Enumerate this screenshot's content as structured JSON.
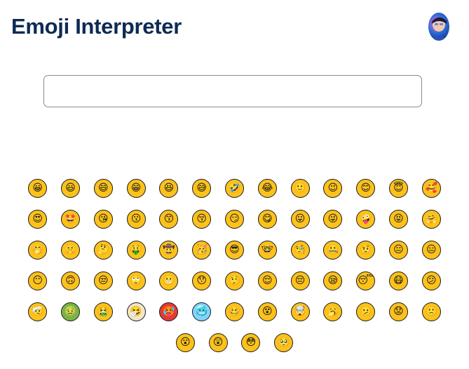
{
  "header": {
    "title": "Emoji Interpreter"
  },
  "search": {
    "value": "",
    "placeholder": ""
  },
  "colors": {
    "title": "#0d2a52",
    "face_yellow": "#fcc21b",
    "face_green": "#7cb342",
    "face_red": "#e53935",
    "face_blue": "#81d4fa",
    "face_pale": "#f2e6c9",
    "outline": "#1a1a1a"
  },
  "emojis": [
    {
      "name": "grinning-face",
      "glyph": "😀",
      "color": "#fcc21b"
    },
    {
      "name": "grinning-face-big-eyes",
      "glyph": "😃",
      "color": "#fcc21b"
    },
    {
      "name": "grinning-face-smiling-eyes",
      "glyph": "😄",
      "color": "#fcc21b"
    },
    {
      "name": "beaming-face",
      "glyph": "😁",
      "color": "#fcc21b"
    },
    {
      "name": "squinting-laughing-face",
      "glyph": "😆",
      "color": "#fcc21b"
    },
    {
      "name": "grinning-sweat-face",
      "glyph": "😅",
      "color": "#fcc21b"
    },
    {
      "name": "rolling-laughing-face",
      "glyph": "🤣",
      "color": "#fcc21b"
    },
    {
      "name": "tears-of-joy-face",
      "glyph": "😂",
      "color": "#fcc21b"
    },
    {
      "name": "slightly-smiling-face",
      "glyph": "🙂",
      "color": "#fcc21b"
    },
    {
      "name": "winking-face",
      "glyph": "😉",
      "color": "#fcc21b"
    },
    {
      "name": "smiling-eyes-face",
      "glyph": "😊",
      "color": "#fcc21b"
    },
    {
      "name": "halo-face",
      "glyph": "😇",
      "color": "#fcc21b"
    },
    {
      "name": "smiling-hearts-face",
      "glyph": "🥰",
      "color": "#fcc21b"
    },
    {
      "name": "heart-eyes-face",
      "glyph": "😍",
      "color": "#fcc21b"
    },
    {
      "name": "star-struck-face",
      "glyph": "🤩",
      "color": "#fcc21b"
    },
    {
      "name": "blowing-kiss-face",
      "glyph": "😘",
      "color": "#fcc21b"
    },
    {
      "name": "kissing-face",
      "glyph": "😗",
      "color": "#fcc21b"
    },
    {
      "name": "kissing-smiling-eyes-face",
      "glyph": "😙",
      "color": "#fcc21b"
    },
    {
      "name": "kissing-closed-eyes-face",
      "glyph": "😚",
      "color": "#fcc21b"
    },
    {
      "name": "smirking-face",
      "glyph": "😏",
      "color": "#fcc21b"
    },
    {
      "name": "yum-face",
      "glyph": "😋",
      "color": "#fcc21b"
    },
    {
      "name": "tongue-face",
      "glyph": "😛",
      "color": "#fcc21b"
    },
    {
      "name": "winking-tongue-face",
      "glyph": "😜",
      "color": "#fcc21b"
    },
    {
      "name": "zany-face",
      "glyph": "🤪",
      "color": "#fcc21b"
    },
    {
      "name": "squinting-tongue-face",
      "glyph": "😝",
      "color": "#fcc21b"
    },
    {
      "name": "hugging-face",
      "glyph": "🤗",
      "color": "#fcc21b"
    },
    {
      "name": "hand-over-mouth-face",
      "glyph": "🤭",
      "color": "#fcc21b"
    },
    {
      "name": "shushing-face",
      "glyph": "🤫",
      "color": "#fcc21b"
    },
    {
      "name": "thinking-face",
      "glyph": "🤔",
      "color": "#fcc21b"
    },
    {
      "name": "money-tongue-face",
      "glyph": "🤑",
      "color": "#fcc21b"
    },
    {
      "name": "cowboy-face",
      "glyph": "🤠",
      "color": "#fcc21b"
    },
    {
      "name": "partying-face",
      "glyph": "🥳",
      "color": "#fcc21b"
    },
    {
      "name": "sunglasses-face",
      "glyph": "😎",
      "color": "#fcc21b"
    },
    {
      "name": "nerd-face",
      "glyph": "🤓",
      "color": "#fcc21b"
    },
    {
      "name": "monocle-face",
      "glyph": "🧐",
      "color": "#fcc21b"
    },
    {
      "name": "zipper-mouth-face",
      "glyph": "🤐",
      "color": "#fcc21b"
    },
    {
      "name": "raised-eyebrow-face",
      "glyph": "🤨",
      "color": "#fcc21b"
    },
    {
      "name": "neutral-face",
      "glyph": "😐",
      "color": "#fcc21b"
    },
    {
      "name": "expressionless-face",
      "glyph": "😑",
      "color": "#fcc21b"
    },
    {
      "name": "no-mouth-face",
      "glyph": "😶",
      "color": "#fcc21b"
    },
    {
      "name": "upside-down-face",
      "glyph": "🙃",
      "color": "#fcc21b"
    },
    {
      "name": "unamused-face",
      "glyph": "😒",
      "color": "#fcc21b"
    },
    {
      "name": "rolling-eyes-face",
      "glyph": "🙄",
      "color": "#fcc21b"
    },
    {
      "name": "grimacing-face",
      "glyph": "😬",
      "color": "#fcc21b"
    },
    {
      "name": "hushed-face",
      "glyph": "😯",
      "color": "#fcc21b"
    },
    {
      "name": "lying-face",
      "glyph": "🤥",
      "color": "#fcc21b"
    },
    {
      "name": "relieved-face",
      "glyph": "😌",
      "color": "#fcc21b"
    },
    {
      "name": "pensive-face",
      "glyph": "😔",
      "color": "#fcc21b"
    },
    {
      "name": "sleepy-face",
      "glyph": "😪",
      "color": "#fcc21b"
    },
    {
      "name": "sleeping-face",
      "glyph": "😴",
      "color": "#fcc21b"
    },
    {
      "name": "mask-face",
      "glyph": "😷",
      "color": "#fcc21b"
    },
    {
      "name": "confused-face",
      "glyph": "😕",
      "color": "#fcc21b"
    },
    {
      "name": "head-bandage-face",
      "glyph": "🤕",
      "color": "#fcc21b"
    },
    {
      "name": "nauseated-face",
      "glyph": "🤢",
      "color": "#7cb342"
    },
    {
      "name": "vomiting-face",
      "glyph": "🤮",
      "color": "#fcc21b"
    },
    {
      "name": "sneezing-face",
      "glyph": "🤧",
      "color": "#f2e6c9"
    },
    {
      "name": "hot-face",
      "glyph": "🥵",
      "color": "#e53935"
    },
    {
      "name": "cold-face",
      "glyph": "🥶",
      "color": "#81d4fa"
    },
    {
      "name": "woozy-face",
      "glyph": "🥴",
      "color": "#fcc21b"
    },
    {
      "name": "dizzy-face",
      "glyph": "😵",
      "color": "#fcc21b"
    },
    {
      "name": "exploding-head-face",
      "glyph": "🤯",
      "color": "#fcc21b"
    },
    {
      "name": "yawning-face",
      "glyph": "🥱",
      "color": "#fcc21b"
    },
    {
      "name": "confused-mouth-face",
      "glyph": "🫤",
      "color": "#fcc21b"
    },
    {
      "name": "worried-face",
      "glyph": "😟",
      "color": "#fcc21b"
    },
    {
      "name": "slightly-frowning-face",
      "glyph": "🙁",
      "color": "#fcc21b"
    },
    {
      "name": "open-mouth-face",
      "glyph": "😮",
      "color": "#fcc21b"
    },
    {
      "name": "astonished-face",
      "glyph": "😲",
      "color": "#fcc21b"
    },
    {
      "name": "flushed-face",
      "glyph": "😳",
      "color": "#fcc21b"
    },
    {
      "name": "pleading-face",
      "glyph": "🥺",
      "color": "#fcc21b"
    }
  ]
}
